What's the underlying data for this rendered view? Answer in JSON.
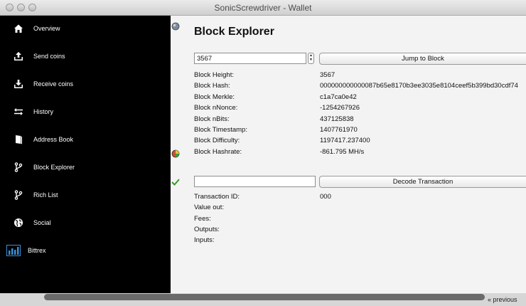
{
  "window": {
    "title": "SonicScrewdriver - Wallet"
  },
  "sidebar": {
    "items": [
      {
        "label": "Overview",
        "icon": "home-icon"
      },
      {
        "label": "Send coins",
        "icon": "upload-icon"
      },
      {
        "label": "Receive coins",
        "icon": "download-icon"
      },
      {
        "label": "History",
        "icon": "transfer-arrows-icon"
      },
      {
        "label": "Address Book",
        "icon": "book-icon"
      },
      {
        "label": "Block Explorer",
        "icon": "branch-icon"
      },
      {
        "label": "Rich List",
        "icon": "branch-icon"
      },
      {
        "label": "Social",
        "icon": "globe-icon"
      },
      {
        "label": "Bittrex",
        "icon": "bar-chart-icon"
      }
    ]
  },
  "main": {
    "title": "Block Explorer",
    "block_input_value": "3567",
    "jump_label": "Jump to Block",
    "block_fields": [
      {
        "label": "Block Height:",
        "value": "3567"
      },
      {
        "label": "Block Hash:",
        "value": "000000000000087b65e8170b3ee3035e8104ceef5b399bd30cdf74"
      },
      {
        "label": "Block Merkle:",
        "value": "c1a7ca0e42"
      },
      {
        "label": "Block nNonce:",
        "value": "-1254267926"
      },
      {
        "label": "Block nBits:",
        "value": "437125838"
      },
      {
        "label": "Block Timestamp:",
        "value": "1407761970"
      },
      {
        "label": "Block Difficulty:",
        "value": "1197417.237400"
      },
      {
        "label": "Block Hashrate:",
        "value": "-861.795 MH/s"
      }
    ],
    "decode_label": "Decode Transaction",
    "tx_fields": [
      {
        "label": "Transaction ID:",
        "value": "000"
      },
      {
        "label": "Value out:",
        "value": ""
      },
      {
        "label": "Fees:",
        "value": ""
      },
      {
        "label": "Outputs:",
        "value": ""
      },
      {
        "label": "Inputs:",
        "value": ""
      }
    ]
  },
  "background": {
    "prev_link": "« previous"
  },
  "colors": {
    "sidebar_bg": "#000000",
    "bittrex_icon": "#3b8fd6",
    "check": "#3a9a2a"
  }
}
